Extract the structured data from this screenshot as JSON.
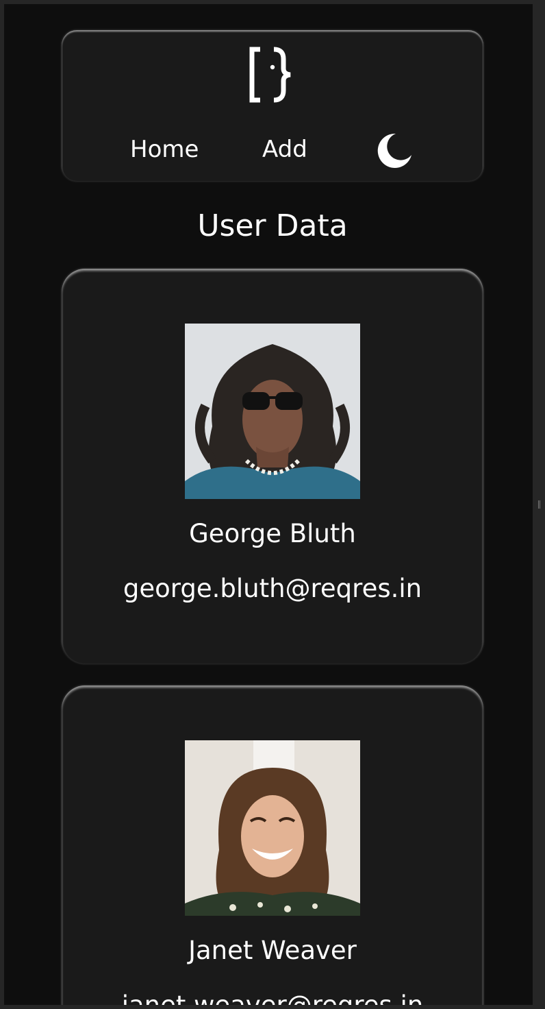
{
  "header": {
    "logo_icon": "bracket-brace-logo-icon",
    "nav": {
      "home_label": "Home",
      "add_label": "Add"
    },
    "theme_toggle_icon": "moon-icon"
  },
  "main": {
    "title": "User Data",
    "users": [
      {
        "name": "George Bluth",
        "email": "george.bluth@reqres.in",
        "avatar_icon": "user-avatar-photo"
      },
      {
        "name": "Janet Weaver",
        "email": "janet.weaver@reqres.in",
        "avatar_icon": "user-avatar-photo"
      }
    ]
  },
  "colors": {
    "background": "#0e0e0e",
    "card": "#1a1a1a",
    "text": "#ffffff",
    "frame": "#262626"
  }
}
